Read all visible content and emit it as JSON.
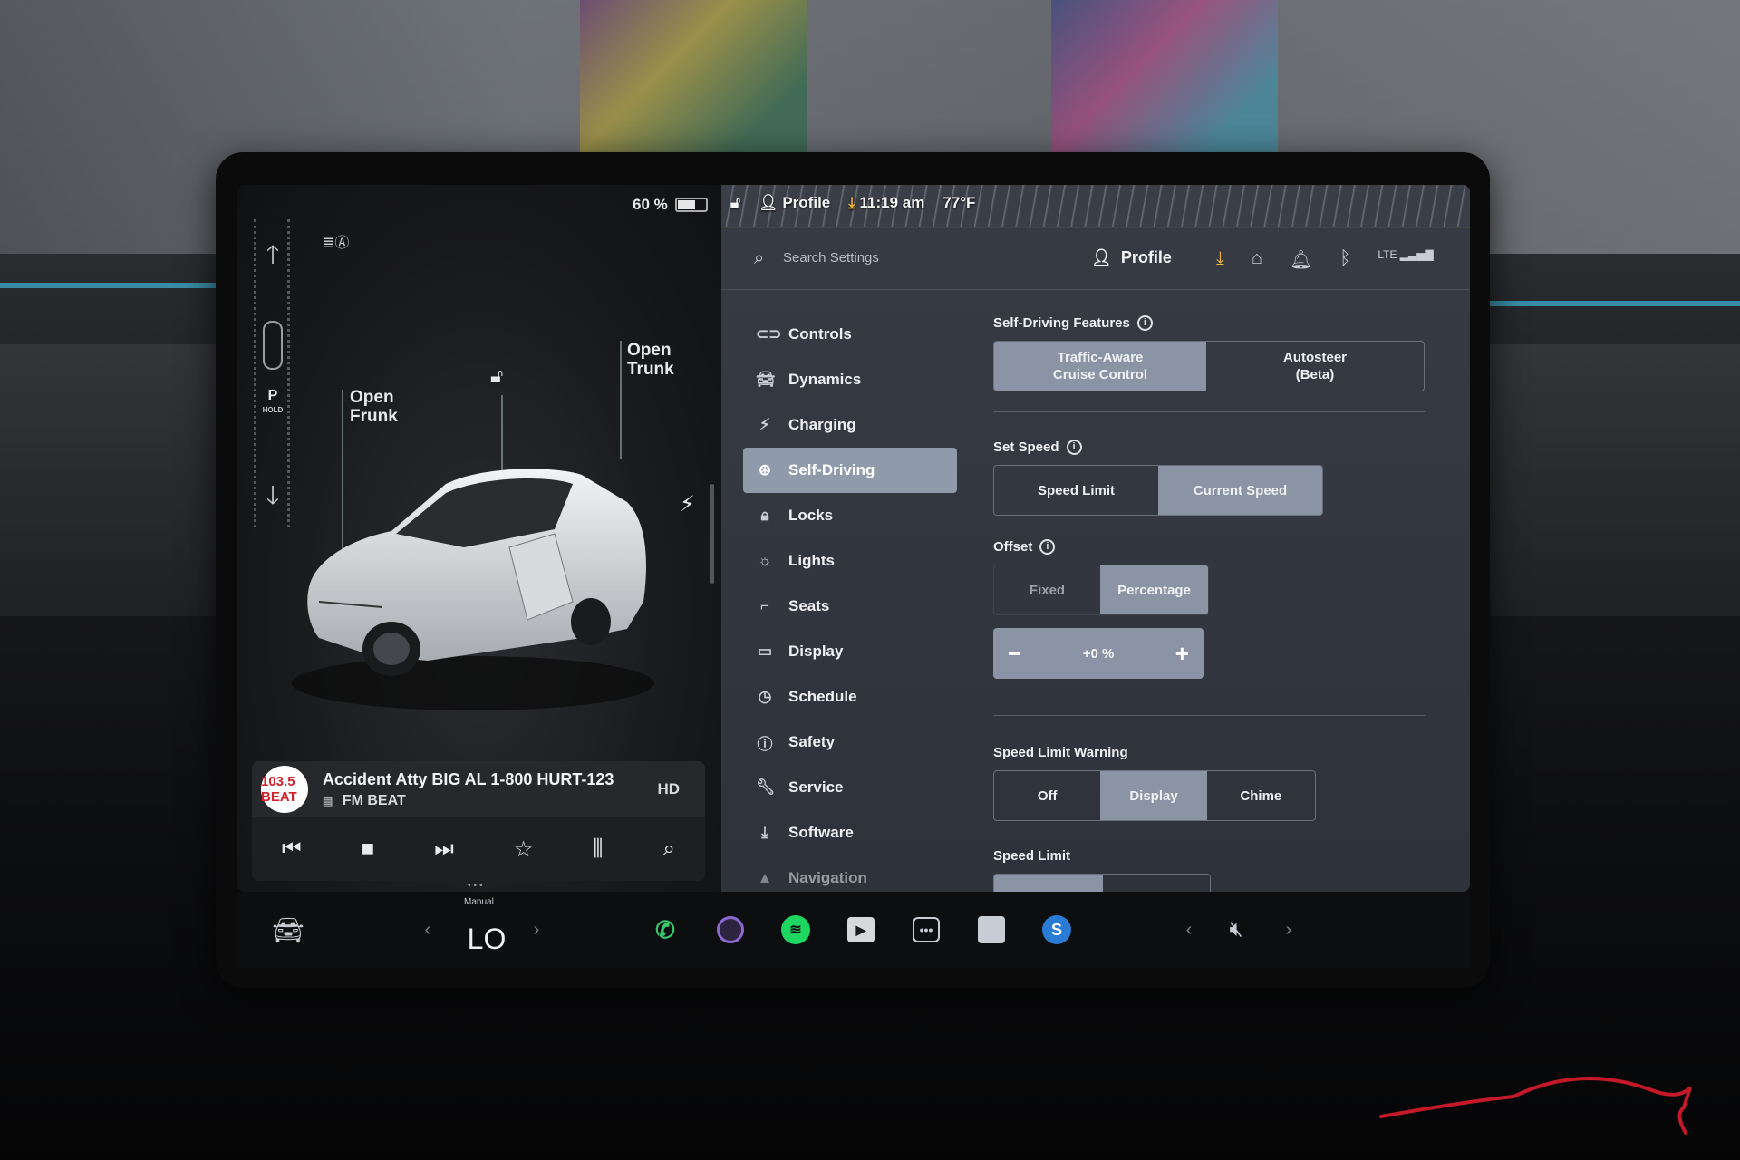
{
  "car": {
    "battery_pct": "60 %",
    "battery_level": 0.6,
    "gear": "P",
    "gear_hold": "HOLD",
    "open_frunk": "Open\nFrunk",
    "open_frunk_l1": "Open",
    "open_frunk_l2": "Frunk",
    "open_trunk_l1": "Open",
    "open_trunk_l2": "Trunk"
  },
  "media": {
    "song": "Accident Atty BIG AL 1-800 HURT-123",
    "station": "FM BEAT",
    "station_logo": "103.5 BEAT",
    "controls": [
      "previous-icon",
      "stop-icon",
      "next-icon",
      "favorite-icon",
      "equalizer-icon",
      "search-icon"
    ]
  },
  "status": {
    "profile": "Profile",
    "time": "11:19 am",
    "temp": "77°F"
  },
  "header": {
    "search_placeholder": "Search Settings",
    "profile": "Profile",
    "lte": "LTE",
    "accent": "#f0b23a"
  },
  "nav": {
    "items": [
      {
        "label": "Controls",
        "icon": "toggle-icon"
      },
      {
        "label": "Dynamics",
        "icon": "car-icon"
      },
      {
        "label": "Charging",
        "icon": "bolt-icon"
      },
      {
        "label": "Self-Driving",
        "icon": "steering-wheel-icon"
      },
      {
        "label": "Locks",
        "icon": "lock-icon"
      },
      {
        "label": "Lights",
        "icon": "sun-icon"
      },
      {
        "label": "Seats",
        "icon": "seat-icon"
      },
      {
        "label": "Display",
        "icon": "display-icon"
      },
      {
        "label": "Schedule",
        "icon": "clock-icon"
      },
      {
        "label": "Safety",
        "icon": "alert-icon"
      },
      {
        "label": "Service",
        "icon": "wrench-icon"
      },
      {
        "label": "Software",
        "icon": "download-icon"
      },
      {
        "label": "Navigation",
        "icon": "navigation-icon"
      }
    ],
    "active": "Self-Driving"
  },
  "self_driving": {
    "features_title": "Self-Driving Features",
    "features": [
      "Traffic-Aware\nCruise Control",
      "Autosteer\n(Beta)"
    ],
    "features_l1": [
      "Traffic-Aware",
      "Autosteer"
    ],
    "features_l2": [
      "Cruise Control",
      "(Beta)"
    ],
    "features_selected": "Traffic-Aware Cruise Control",
    "set_speed_title": "Set Speed",
    "set_speed": [
      "Speed Limit",
      "Current Speed"
    ],
    "set_speed_selected": "Current Speed",
    "offset_title": "Offset",
    "offset": [
      "Fixed",
      "Percentage"
    ],
    "offset_selected": "Percentage",
    "offset_value": "+0 %",
    "warning_title": "Speed Limit Warning",
    "warning": [
      "Off",
      "Display",
      "Chime"
    ],
    "warning_selected": "Display",
    "speed_limit_title": "Speed Limit"
  },
  "dock": {
    "climate_mode": "Manual",
    "climate_temp": "LO",
    "apps": [
      "phone-icon",
      "camera-icon",
      "spotify-icon",
      "theater-icon",
      "more-icon",
      "toybox-icon",
      "siriusxm-icon"
    ]
  }
}
